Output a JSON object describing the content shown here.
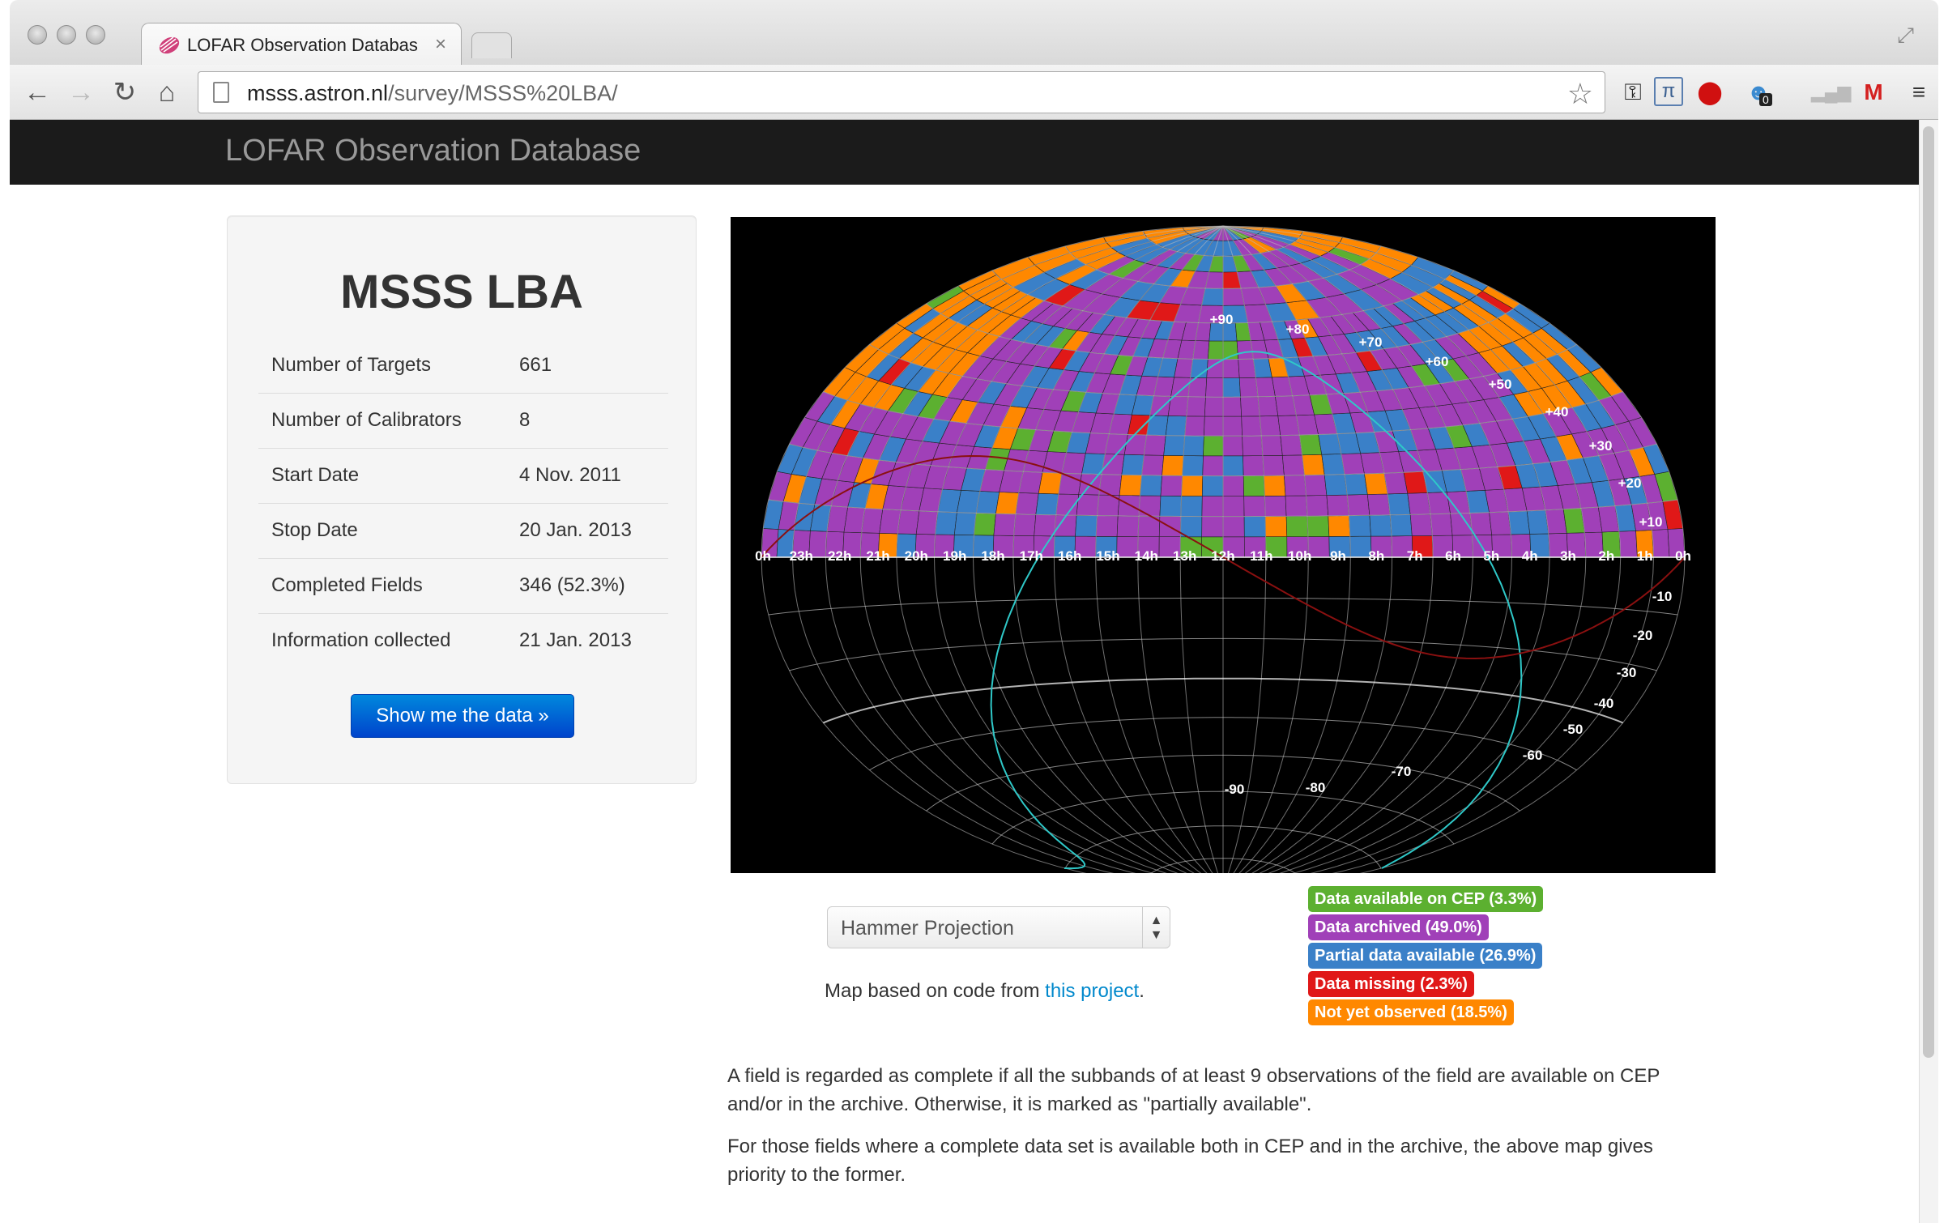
{
  "browser": {
    "tab_title": "LOFAR Observation Databas",
    "tab_close": "×",
    "url_host": "msss.astron.nl",
    "url_path": "/survey/MSSS%20LBA/",
    "extension_badge": "0",
    "icons": [
      "back-icon",
      "forward-icon",
      "reload-icon",
      "home-icon",
      "star-icon",
      "menu-icon"
    ]
  },
  "navbar": {
    "brand": "LOFAR Observation Database"
  },
  "survey": {
    "title": "MSSS LBA",
    "rows": [
      {
        "label": "Number of Targets",
        "value": "661"
      },
      {
        "label": "Number of Calibrators",
        "value": "8"
      },
      {
        "label": "Start Date",
        "value": "4 Nov. 2011"
      },
      {
        "label": "Stop Date",
        "value": "20 Jan. 2013"
      },
      {
        "label": "Completed Fields",
        "value": "346 (52.3%)"
      },
      {
        "label": "Information collected",
        "value": "21 Jan. 2013"
      }
    ],
    "button": "Show me the data »"
  },
  "map": {
    "ra_labels": [
      "0h",
      "23h",
      "22h",
      "21h",
      "20h",
      "19h",
      "18h",
      "17h",
      "16h",
      "15h",
      "14h",
      "13h",
      "12h",
      "11h",
      "10h",
      "9h",
      "8h",
      "7h",
      "6h",
      "5h",
      "4h",
      "3h",
      "2h",
      "1h",
      "0h"
    ],
    "dec_labels_top": [
      "+90",
      "+80",
      "+70",
      "+60",
      "+50",
      "+40",
      "+30",
      "+20",
      "+10"
    ],
    "dec_labels_right": [
      "-10",
      "-20",
      "-30",
      "-40",
      "-50",
      "-60"
    ],
    "dec_labels_bottom": [
      "-70",
      "-80",
      "-90"
    ],
    "projection": "Hammer Projection",
    "credit_prefix": "Map based on code from ",
    "credit_link": "this project",
    "credit_suffix": "."
  },
  "legend": [
    {
      "label": "Data available on CEP (3.3%)",
      "color": "#5cb030"
    },
    {
      "label": "Data archived (49.0%)",
      "color": "#a040b8"
    },
    {
      "label": "Partial data available (26.9%)",
      "color": "#3a80c8"
    },
    {
      "label": "Data missing (2.3%)",
      "color": "#e01818"
    },
    {
      "label": "Not yet observed (18.5%)",
      "color": "#ff8800"
    }
  ],
  "notes": [
    "A field is regarded as complete if all the subbands of at least 9 observations of the field are available on CEP and/or in the archive. Otherwise, it is marked as \"partially available\".",
    "For those fields where a complete data set is available both in CEP and in the archive, the above map gives priority to the former."
  ]
}
